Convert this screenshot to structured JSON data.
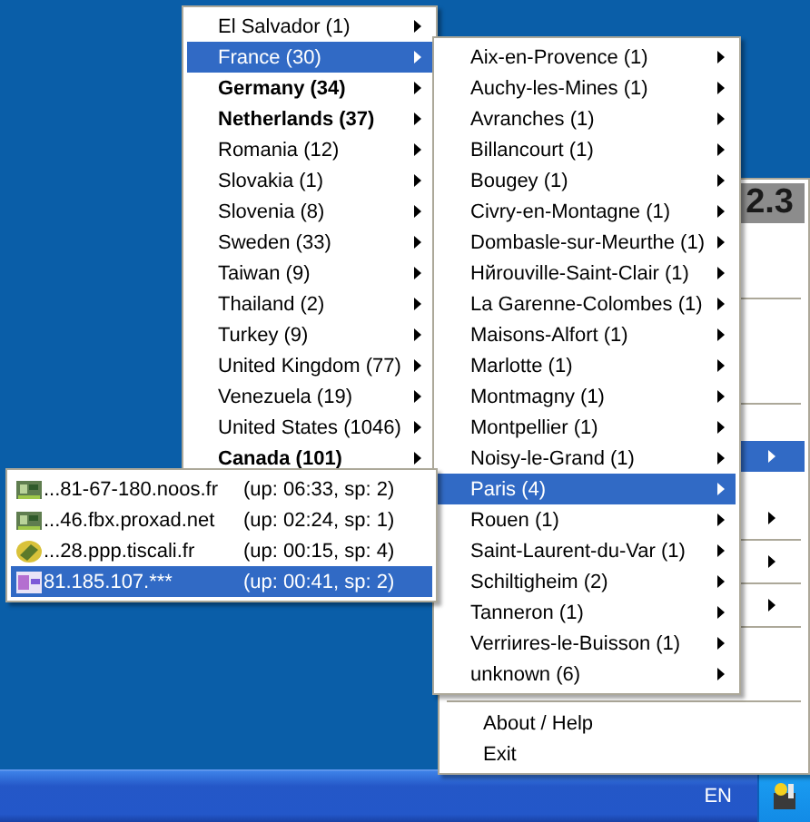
{
  "countries": [
    {
      "label": "El Salvador (1)",
      "bold": false,
      "selected": false
    },
    {
      "label": "France (30)",
      "bold": false,
      "selected": true
    },
    {
      "label": "Germany (34)",
      "bold": true,
      "selected": false
    },
    {
      "label": "Netherlands (37)",
      "bold": true,
      "selected": false
    },
    {
      "label": "Romania (12)",
      "bold": false,
      "selected": false
    },
    {
      "label": "Slovakia (1)",
      "bold": false,
      "selected": false
    },
    {
      "label": "Slovenia (8)",
      "bold": false,
      "selected": false
    },
    {
      "label": "Sweden (33)",
      "bold": false,
      "selected": false
    },
    {
      "label": "Taiwan (9)",
      "bold": false,
      "selected": false
    },
    {
      "label": "Thailand (2)",
      "bold": false,
      "selected": false
    },
    {
      "label": "Turkey (9)",
      "bold": false,
      "selected": false
    },
    {
      "label": "United Kingdom (77)",
      "bold": false,
      "selected": false
    },
    {
      "label": "Venezuela (19)",
      "bold": false,
      "selected": false
    },
    {
      "label": "United States (1046)",
      "bold": false,
      "selected": false
    },
    {
      "label": "Canada (101)",
      "bold": true,
      "selected": false
    }
  ],
  "cities": [
    {
      "label": "Aix-en-Provence (1)",
      "selected": false
    },
    {
      "label": "Auchy-les-Mines (1)",
      "selected": false
    },
    {
      "label": "Avranches (1)",
      "selected": false
    },
    {
      "label": "Billancourt (1)",
      "selected": false
    },
    {
      "label": "Bougey (1)",
      "selected": false
    },
    {
      "label": "Civry-en-Montagne (1)",
      "selected": false
    },
    {
      "label": "Dombasle-sur-Meurthe (1)",
      "selected": false
    },
    {
      "label": "Hйrouville-Saint-Clair (1)",
      "selected": false
    },
    {
      "label": "La Garenne-Colombes (1)",
      "selected": false
    },
    {
      "label": "Maisons-Alfort (1)",
      "selected": false
    },
    {
      "label": "Marlotte (1)",
      "selected": false
    },
    {
      "label": "Montmagny (1)",
      "selected": false
    },
    {
      "label": "Montpellier (1)",
      "selected": false
    },
    {
      "label": "Noisy-le-Grand (1)",
      "selected": false
    },
    {
      "label": "Paris (4)",
      "selected": true
    },
    {
      "label": "Rouen (1)",
      "selected": false
    },
    {
      "label": "Saint-Laurent-du-Var (1)",
      "selected": false
    },
    {
      "label": "Schiltigheim (2)",
      "selected": false
    },
    {
      "label": "Tanneron (1)",
      "selected": false
    },
    {
      "label": "Verriиres-le-Buisson (1)",
      "selected": false
    },
    {
      "label": "unknown (6)",
      "selected": false
    }
  ],
  "hosts": [
    {
      "host": "...81-67-180.noos.fr",
      "status": "(up: 06:33, sp: 2)",
      "kind": "network",
      "selected": false
    },
    {
      "host": "...46.fbx.proxad.net",
      "status": "(up: 02:24, sp: 1)",
      "kind": "network",
      "selected": false
    },
    {
      "host": "...28.ppp.tiscali.fr",
      "status": "(up: 00:15, sp: 4)",
      "kind": "modem",
      "selected": false
    },
    {
      "host": "81.185.107.***",
      "status": "(up: 00:41, sp: 2)",
      "kind": "screen",
      "selected": true
    }
  ],
  "tray_menu": {
    "header": "2.3",
    "items": [
      {
        "kind": "covered"
      },
      {
        "kind": "covered"
      },
      {
        "kind": "separator"
      },
      {
        "kind": "covered"
      },
      {
        "kind": "covered"
      },
      {
        "kind": "covered"
      },
      {
        "kind": "separator"
      },
      {
        "kind": "covered"
      },
      {
        "kind": "submenu",
        "selected": true
      },
      {
        "kind": "covered"
      },
      {
        "kind": "submenu",
        "selected": false
      },
      {
        "kind": "separator"
      },
      {
        "kind": "submenu",
        "selected": false
      },
      {
        "kind": "separator"
      },
      {
        "kind": "submenu",
        "selected": false
      },
      {
        "kind": "separator"
      },
      {
        "kind": "covered"
      },
      {
        "kind": "covered"
      },
      {
        "kind": "separator"
      },
      {
        "kind": "command",
        "label": "About / Help"
      },
      {
        "kind": "command",
        "label": "Exit"
      }
    ]
  },
  "taskbar": {
    "language": "EN"
  }
}
